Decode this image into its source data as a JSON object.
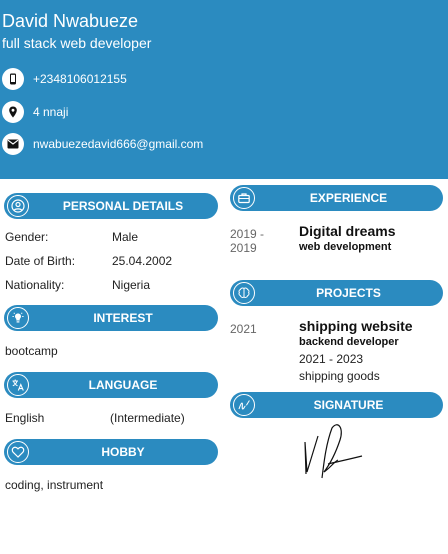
{
  "header": {
    "name": "David Nwabueze",
    "title": "full stack web developer",
    "contacts": [
      {
        "icon": "phone-icon",
        "text": "+2348106012155"
      },
      {
        "icon": "location-pin-icon",
        "text": "4 nnaji"
      },
      {
        "icon": "mail-icon",
        "text": "nwabuezedavid666@gmail.com"
      }
    ]
  },
  "personal": {
    "heading": "PERSONAL DETAILS",
    "rows": [
      {
        "label": "Gender:",
        "value": "Male"
      },
      {
        "label": "Date of Birth:",
        "value": "25.04.2002"
      },
      {
        "label": "Nationality:",
        "value": "Nigeria"
      }
    ]
  },
  "interest": {
    "heading": "INTEREST",
    "text": "bootcamp"
  },
  "language": {
    "heading": "LANGUAGE",
    "name": "English",
    "level": "(Intermediate)"
  },
  "hobby": {
    "heading": "HOBBY",
    "text": "coding, instrument"
  },
  "experience": {
    "heading": "EXPERIENCE",
    "years_line1": "2019 -",
    "years_line2": "2019",
    "company": "Digital dreams",
    "role": "web development"
  },
  "projects": {
    "heading": "PROJECTS",
    "year": "2021",
    "name": "shipping website",
    "role": "backend developer",
    "period": "2021 - 2023",
    "description": "shipping goods"
  },
  "signature": {
    "heading": "SIGNATURE"
  },
  "colors": {
    "primary": "#2b8bc0",
    "white": "#ffffff"
  }
}
